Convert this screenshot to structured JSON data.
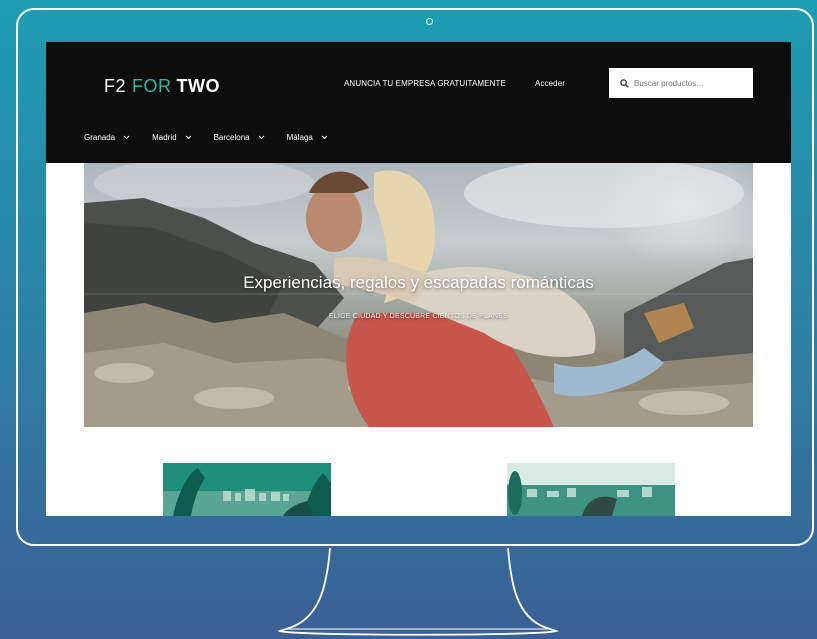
{
  "site": {
    "logo": {
      "mark": "F2",
      "word1": "FOR",
      "word2": "TWO"
    },
    "top_links": [
      {
        "label": "ANUNCIA TU EMPRESA GRATUITAMENTE"
      },
      {
        "label": "Acceder"
      }
    ],
    "search": {
      "placeholder": "Buscar productos…"
    },
    "cities": [
      {
        "label": "Granada"
      },
      {
        "label": "Madrid"
      },
      {
        "label": "Barcelona"
      },
      {
        "label": "Málaga"
      }
    ],
    "hero": {
      "title": "Experiencias, regalos y escapadas románticas",
      "subtitle": "ELIGE CIUDAD Y DESCUBRE CIENTOS DE PLANES"
    }
  },
  "icons": {
    "search": "search-icon",
    "dropdown": "chevron-down-icon"
  },
  "colors": {
    "background_top": "#1d9db2",
    "background_bottom": "#3a5f95",
    "header": "#0d0d0d",
    "accent": "#2fb7a4"
  }
}
